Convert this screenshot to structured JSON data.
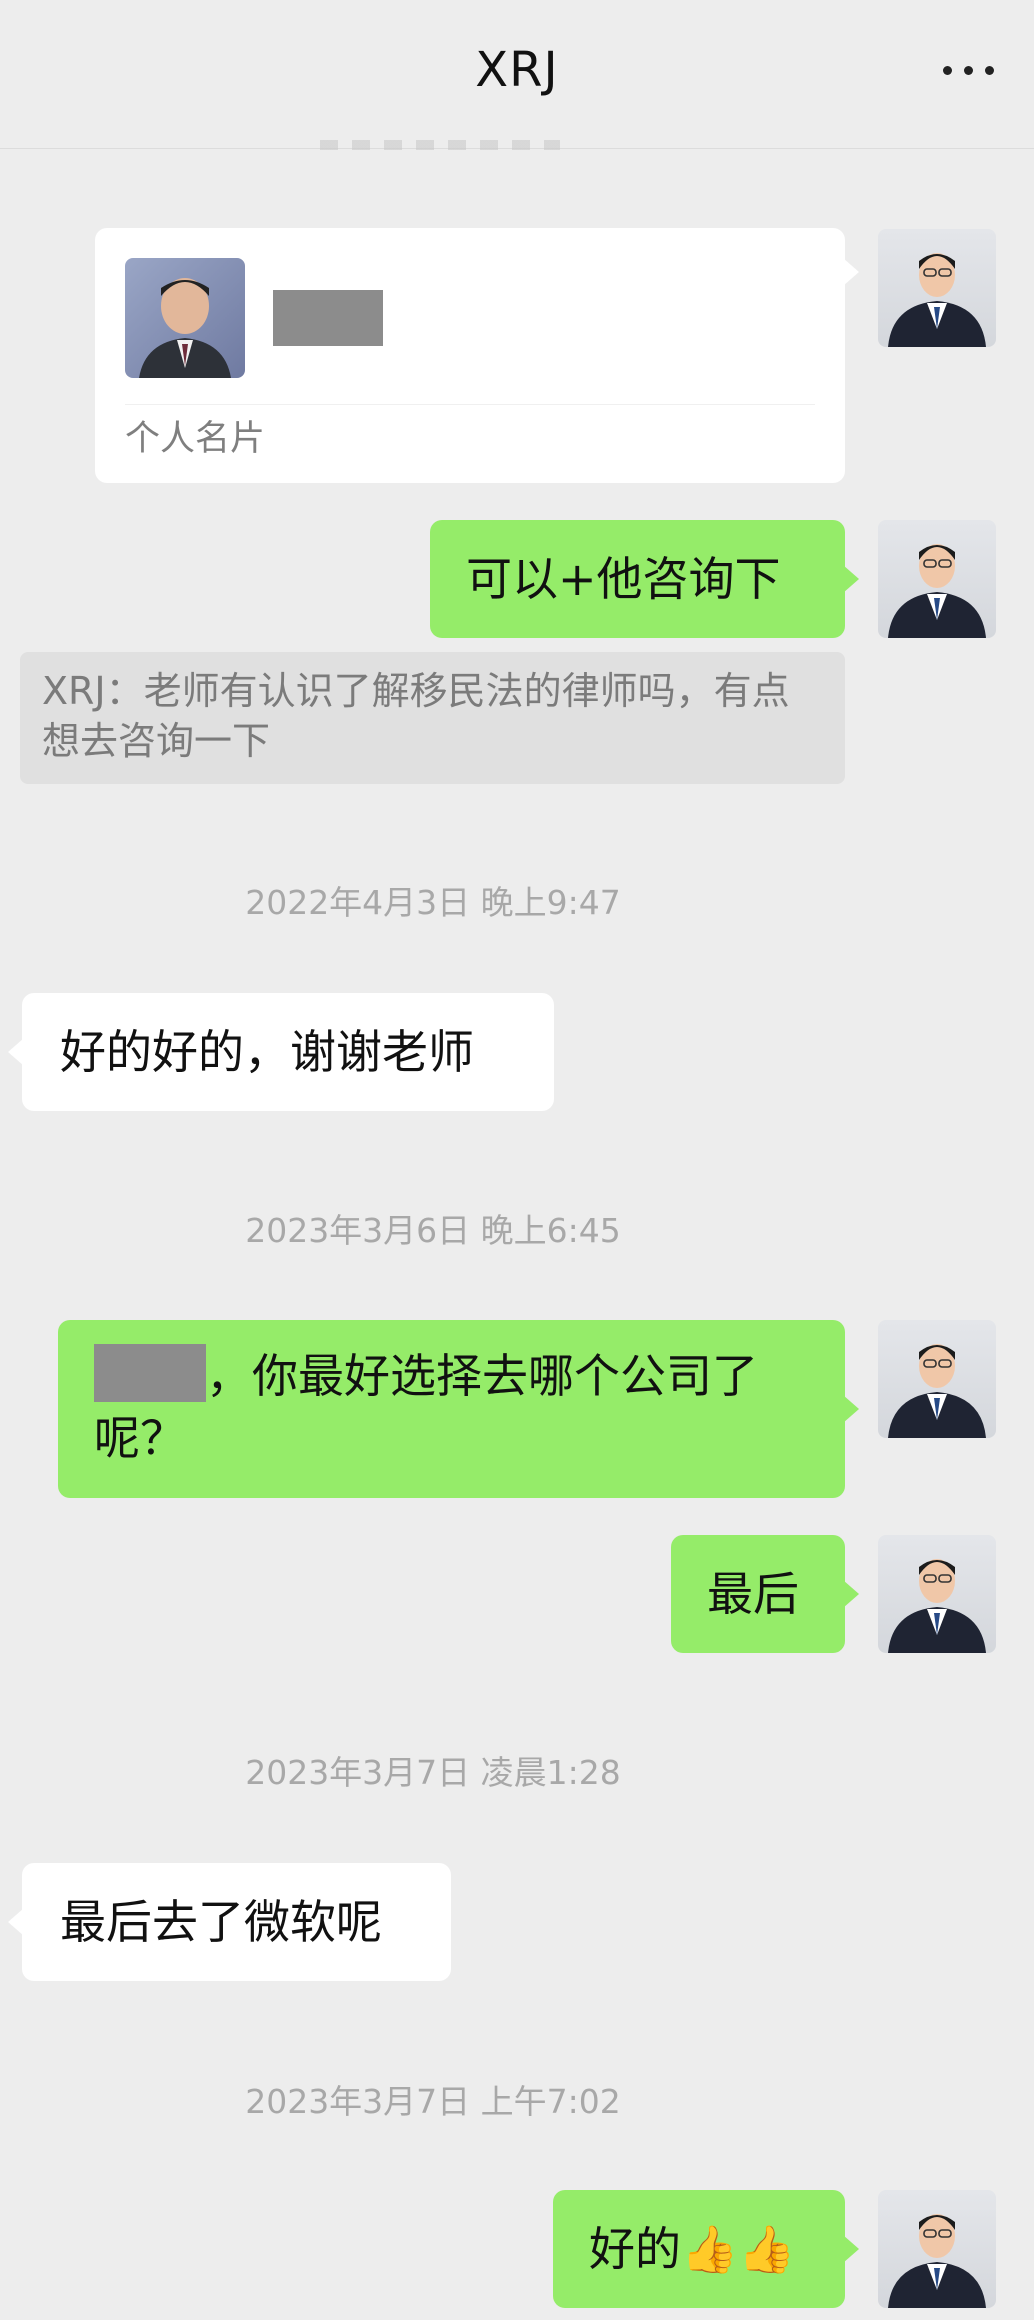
{
  "header": {
    "title": "XRJ"
  },
  "card": {
    "label": "个人名片"
  },
  "messages": {
    "m1": "可以+他咨询下",
    "quote": "XRJ：老师有认识了解移民法的律师吗，有点想去咨询一下",
    "ts1": "2022年4月3日 晚上9:47",
    "m2": "好的好的，谢谢老师",
    "ts2": "2023年3月6日 晚上6:45",
    "m3_suffix": "，你最好选择去哪个公司了呢？",
    "m4": "最后",
    "ts3": "2023年3月7日 凌晨1:28",
    "m5": "最后去了微软呢",
    "ts4": "2023年3月7日 上午7:02",
    "m6": "好的👍👍"
  }
}
